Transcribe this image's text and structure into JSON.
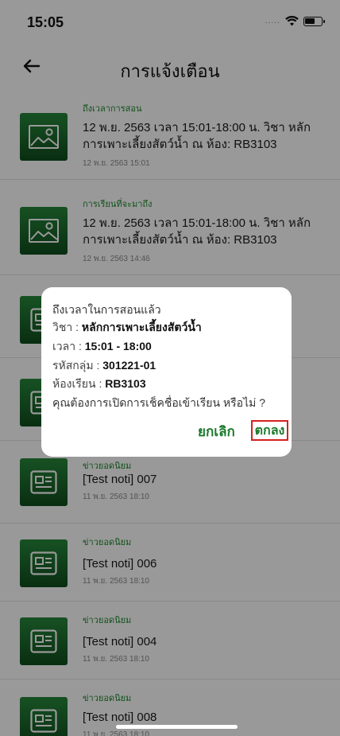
{
  "status_bar": {
    "time": "15:05",
    "signal_dots": "....."
  },
  "nav": {
    "title": "การแจ้งเตือน"
  },
  "notifications": [
    {
      "category": "ถึงเวลาการสอน",
      "body": "12 พ.ย. 2563 เวลา 15:01-18:00 น. วิชา หลักการเพาะเลี้ยงสัตว์น้ำ ณ ห้อง: RB3103",
      "time": "12 พ.ย. 2563 15:01",
      "icon": "image-icon"
    },
    {
      "category": "การเรียนที่จะมาถึง",
      "body": "12 พ.ย. 2563 เวลา 15:01-18:00 น. วิชา หลักการเพาะเลี้ยงสัตว์น้ำ ณ ห้อง: RB3103",
      "time": "12 พ.ย. 2563 14:46",
      "icon": "image-icon"
    },
    {
      "category": "",
      "body": "",
      "time": "",
      "icon": "newspaper-icon"
    },
    {
      "category": "",
      "body": "",
      "time": "",
      "icon": "newspaper-icon"
    },
    {
      "category": "ข่าวยอดนิยม",
      "body": "[Test noti] 007",
      "time": "11 พ.ย. 2563 18:10",
      "icon": "newspaper-icon"
    },
    {
      "category": "ข่าวยอดนิยม",
      "body": "[Test noti] 006",
      "time": "11 พ.ย. 2563 18:10",
      "icon": "newspaper-icon"
    },
    {
      "category": "ข่าวยอดนิยม",
      "body": "[Test noti] 004",
      "time": "11 พ.ย. 2563 18:10",
      "icon": "newspaper-icon"
    },
    {
      "category": "ข่าวยอดนิยม",
      "body": "[Test noti] 008",
      "time": "11 พ.ย. 2563 18:10",
      "icon": "newspaper-icon"
    }
  ],
  "dialog": {
    "title": "ถึงเวลาในการสอนแล้ว",
    "subject_label": "วิชา : ",
    "subject_value": "หลักการเพาะเลี้ยงสัตว์น้ำ",
    "time_label": "เวลา : ",
    "time_value": "15:01 - 18:00",
    "group_label": "รหัสกลุ่ม : ",
    "group_value": "301221-01",
    "room_label": "ห้องเรียน : ",
    "room_value": "RB3103",
    "question": "คุณต้องการเปิดการเช็คชื่อเข้าเรียน หรือไม่ ?",
    "cancel_label": "ยกเลิก",
    "ok_label": "ตกลง"
  },
  "colors": {
    "accent_green": "#1b7a2b",
    "highlight_red": "#d62020",
    "thumb_green": "#1f6e2e"
  }
}
